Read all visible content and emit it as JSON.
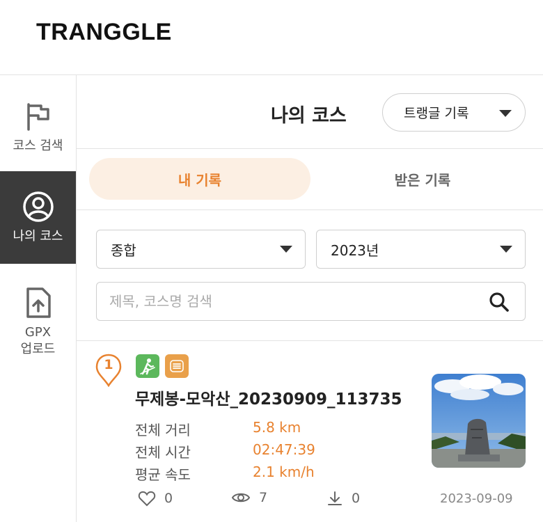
{
  "header": {
    "logo": "TRANGGLE"
  },
  "sidebar": {
    "items": [
      {
        "label": "코스 검색",
        "icon": "flag-icon",
        "active": false
      },
      {
        "label": "나의 코스",
        "icon": "user-circle-icon",
        "active": true
      },
      {
        "label_line1": "GPX",
        "label_line2": "업로드",
        "icon": "file-upload-icon",
        "active": false
      }
    ]
  },
  "main": {
    "title": "나의 코스",
    "record_select": {
      "value": "트랭글 기록",
      "icon": "caret-down-icon"
    },
    "tabs": [
      {
        "label": "내 기록",
        "active": true
      },
      {
        "label": "받은 기록",
        "active": false
      }
    ],
    "filters": {
      "type": {
        "value": "종합"
      },
      "year": {
        "value": "2023년"
      }
    },
    "search": {
      "placeholder": "제목, 코스명 검색",
      "value": "",
      "icon": "search-icon"
    }
  },
  "courses": [
    {
      "rank": "1",
      "badges": [
        "hiking-icon",
        "list-icon"
      ],
      "title": "무제봉-모악산_20230909_113735",
      "stats": [
        {
          "label": "전체 거리",
          "value": "5.8 km"
        },
        {
          "label": "전체 시간",
          "value": "02:47:39"
        },
        {
          "label": "평균 속도",
          "value": "2.1 km/h"
        }
      ],
      "likes": "0",
      "views": "7",
      "downloads": "0",
      "date": "2023-09-09"
    }
  ],
  "colors": {
    "accent": "#e8822f",
    "active_tab_bg": "#fcefe3",
    "sidebar_active_bg": "#3b3b3b",
    "hike_badge": "#5cb85c",
    "list_badge": "#e9a04a"
  }
}
